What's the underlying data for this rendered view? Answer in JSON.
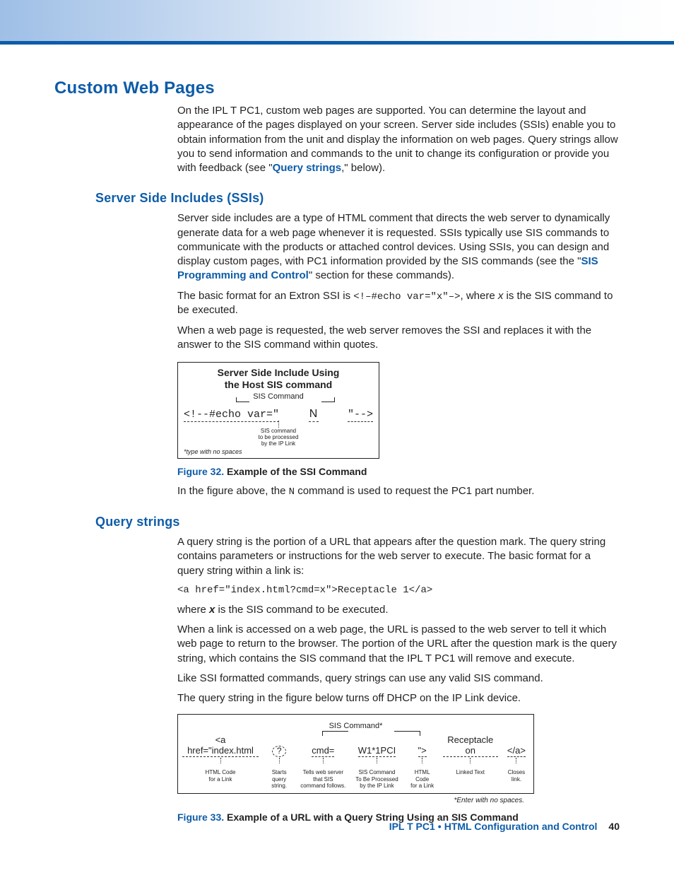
{
  "h1": "Custom Web Pages",
  "intro": "On the IPL T PC1, custom web pages are supported. You can determine the layout and appearance of the pages displayed on your screen. Server side includes (SSIs) enable you to obtain information from the unit and display the information on web pages. Query strings allow you to send information and commands to the unit to change its configuration or provide you with feedback (see \"",
  "intro_link": "Query strings",
  "intro_tail": ",\" below).",
  "ssi": {
    "heading": "Server Side Includes (SSIs)",
    "p1a": "Server side includes are a type of HTML comment that directs the web server to dynamically generate data for a web page whenever it is requested. SSIs typically use SIS commands to communicate with the products or attached control devices. Using SSIs, you can design and display custom pages, with PC1 information provided by the SIS commands (see the \"",
    "p1_link": "SIS Programming and Control",
    "p1b": "\" section for these commands).",
    "p2a": "The basic format for an Extron SSI is ",
    "p2_code": "<!–#echo var=\"x\"–>",
    "p2b": ", where ",
    "p2c": " is the SIS command to be executed.",
    "p3": "When a web page is requested, the web server removes the SSI and replaces it with the answer to the SIS command within quotes."
  },
  "fig32": {
    "title1": "Server Side Include Using",
    "title2": "the Host SIS command",
    "sis_label": "SIS Command",
    "echo": "<!--#echo var=\"",
    "n": "N",
    "close": "\"-->",
    "sub1": "SIS command",
    "sub2": "to be processed",
    "sub3": "by the IP Link",
    "foot": "*type with no spaces",
    "caption_num": "Figure 32.",
    "caption_title": "Example of the SSI Command",
    "after": "In the figure above, the ",
    "after_code": "N",
    "after_tail": " command is used to request the PC1 part number."
  },
  "qs": {
    "heading": "Query strings",
    "p1": "A query string is the portion of a URL that appears after the question mark. The query string contains parameters or instructions for the web server to execute. The basic format for a query string within a link is:",
    "code": "<a href=\"index.html?cmd=x\">Receptacle 1</a>",
    "p2a": "where ",
    "p2b": " is the SIS command to be executed.",
    "p3": "When a link is accessed on a web page, the URL is passed to the web server to tell it which web page to return to the browser. The portion of the URL after the question mark is the query string, which contains the SIS command that the IPL T PC1 will remove and execute.",
    "p4": "Like SSI formatted commands, query strings can use any valid SIS command.",
    "p5": "The query string in the figure below turns off DHCP on the IP Link device."
  },
  "fig33": {
    "header": "SIS Command*",
    "t1": "<a href=\"index.html",
    "t1_sub": "HTML Code\nfor a Link",
    "t2": "?",
    "t2_sub": "Starts\nquery string.",
    "t3": "cmd=",
    "t3_sub": "Tells web server\nthat SIS\ncommand follows.",
    "t4": "W1*1PCI",
    "t4_sub": "SIS Command\nTo Be Processed\nby the IP Link",
    "t5": "\">",
    "t5_sub": "HTML Code\nfor a Link",
    "t6": "Receptacle on",
    "t6_sub": "Linked Text",
    "t7": "</a>",
    "t7_sub": "Closes\nlink.",
    "note": "*Enter with no spaces.",
    "caption_num": "Figure 33.",
    "caption_title": "Example of a URL with a Query String Using an SIS Command"
  },
  "footer": {
    "product": "IPL T PC1",
    "section": "HTML Configuration and Control",
    "page": "40"
  }
}
